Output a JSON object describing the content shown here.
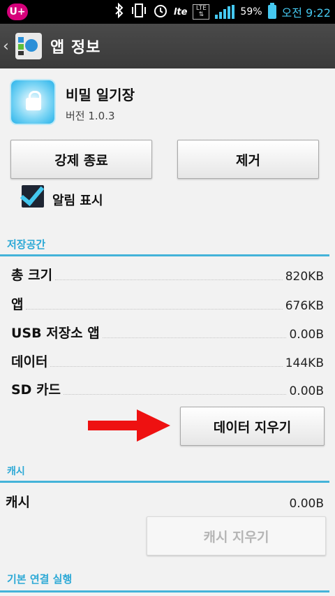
{
  "status_bar": {
    "carrier_logo": "U+",
    "network": "lte",
    "lte_badge": "LTE",
    "battery": "59%",
    "time": "오전 9:22",
    "icons": [
      "bluetooth-icon",
      "vibrate-icon",
      "alarm-icon",
      "lte-icon",
      "signal-icon",
      "battery-icon"
    ]
  },
  "action_bar": {
    "title": "앱 정보"
  },
  "app": {
    "name": "비밀 일기장",
    "version": "버전 1.0.3"
  },
  "buttons": {
    "force_stop": "강제 종료",
    "uninstall": "제거",
    "clear_data": "데이터 지우기",
    "clear_cache": "캐시 지우기"
  },
  "notification": {
    "label": "알림 표시",
    "checked": true
  },
  "storage": {
    "header": "저장공간",
    "rows": [
      {
        "label": "총 크기",
        "value": "820KB"
      },
      {
        "label": "앱",
        "value": "676KB"
      },
      {
        "label": "USB 저장소 앱",
        "value": "0.00B"
      },
      {
        "label": "데이터",
        "value": "144KB"
      },
      {
        "label": "SD 카드",
        "value": "0.00B"
      }
    ]
  },
  "cache": {
    "header": "캐시",
    "label": "캐시",
    "value": "0.00B"
  },
  "launch_default": {
    "header": "기본 연결 실행"
  },
  "colors": {
    "accent": "#2da9d6",
    "arrow": "#ee1111",
    "checkbox": "#1e2533"
  }
}
